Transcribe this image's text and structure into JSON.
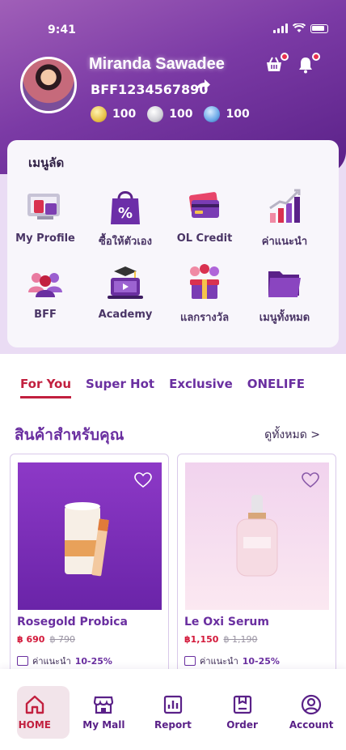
{
  "status_bar": {
    "time": "9:41"
  },
  "profile": {
    "name": "Miranda Sawadee",
    "member_id": "BFF1234567890",
    "coins": [
      {
        "type": "gold",
        "value": "100"
      },
      {
        "type": "silver",
        "value": "100"
      },
      {
        "type": "blue",
        "value": "100"
      }
    ]
  },
  "menu": {
    "title": "เมนูลัด",
    "items": [
      {
        "label": "My Profile",
        "icon": "profile-cards-icon"
      },
      {
        "label": "ซื้อให้ตัวเอง",
        "icon": "shopping-bag-percent-icon"
      },
      {
        "label": "OL Credit",
        "icon": "credit-card-icon"
      },
      {
        "label": "ค่าแนะนำ",
        "icon": "growth-chart-icon"
      },
      {
        "label": "BFF",
        "icon": "group-users-icon"
      },
      {
        "label": "Academy",
        "icon": "academy-laptop-icon"
      },
      {
        "label": "แลกรางวัล",
        "icon": "gift-balloons-icon"
      },
      {
        "label": "เมนูทั้งหมด",
        "icon": "folder-icon"
      }
    ]
  },
  "tabs": [
    "For You",
    "Super Hot",
    "Exclusive",
    "ONELIFE"
  ],
  "section": {
    "title": "สินค้าสำหรับคุณ",
    "see_all": "ดูทั้งหมด >"
  },
  "products": [
    {
      "name": "Rosegold Probica",
      "price": "฿ 690",
      "old_price": "฿ 790",
      "commission_label": "ค่าแนะนำ",
      "commission": "10-25%"
    },
    {
      "name": "Le Oxi Serum",
      "price": "฿1,150",
      "old_price": "฿ 1,190",
      "commission_label": "ค่าแนะนำ",
      "commission": "10-25%"
    }
  ],
  "bottom_nav": [
    {
      "label": "HOME",
      "icon": "home-icon"
    },
    {
      "label": "My Mall",
      "icon": "store-icon"
    },
    {
      "label": "Report",
      "icon": "report-icon"
    },
    {
      "label": "Order",
      "icon": "order-box-icon"
    },
    {
      "label": "Account",
      "icon": "account-icon"
    }
  ],
  "colors": {
    "primary": "#6a2fa0",
    "accent": "#c2203f",
    "header_dark": "#5a2188"
  }
}
